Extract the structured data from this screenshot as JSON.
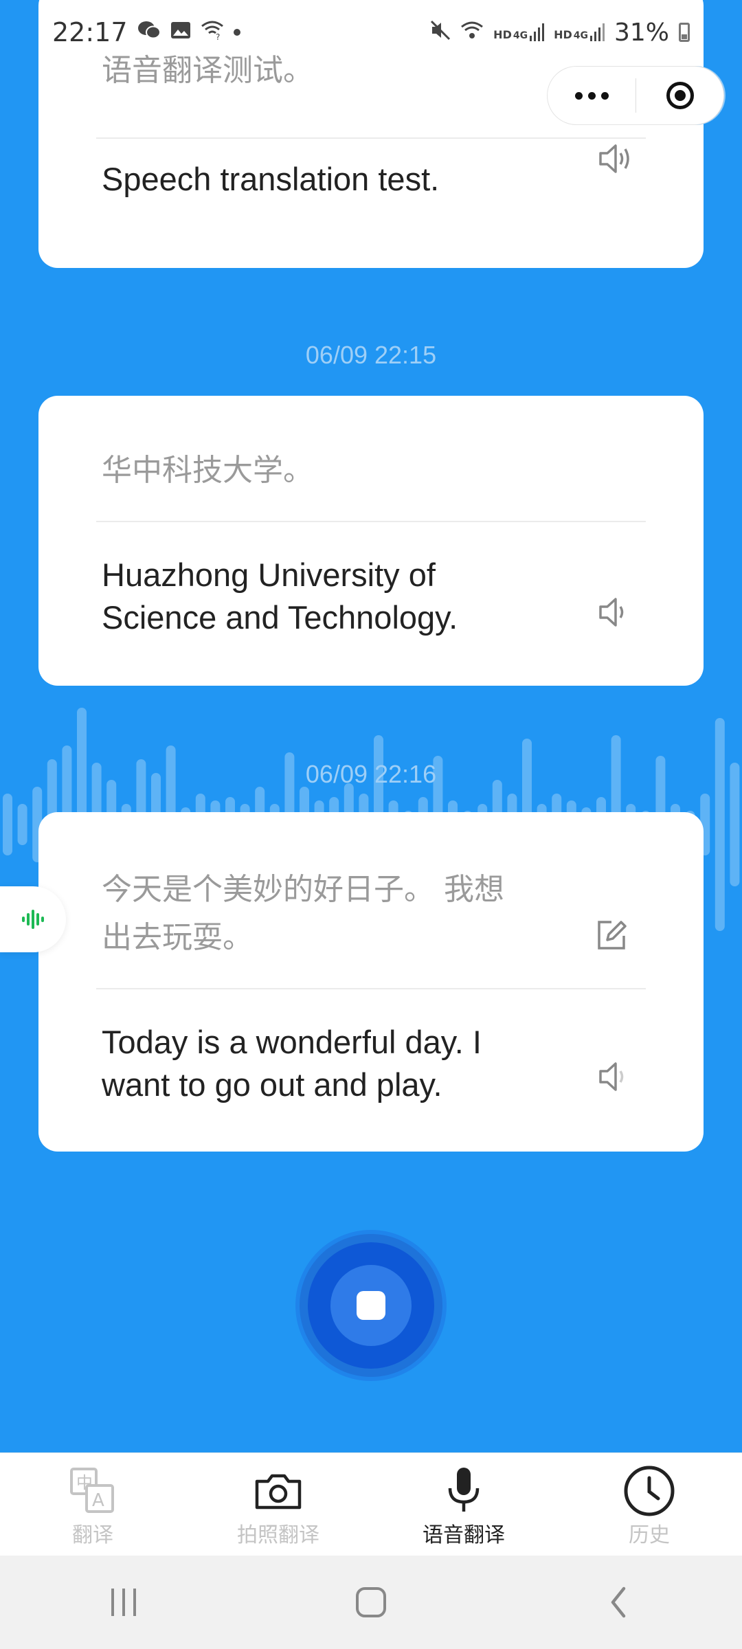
{
  "status_bar": {
    "time": "22:17",
    "battery": "31%",
    "left_icons": [
      "wechat-icon",
      "image-icon",
      "wifi-question-icon",
      "dot-icon"
    ],
    "right_icons": [
      "mute-icon",
      "wifi-icon",
      "hd-4g-signal-icon",
      "hd-4g-signal-icon",
      "battery-icon"
    ],
    "hd_label": "HD",
    "net_label": "4G"
  },
  "capsule": {
    "more_icon": "more-dots-icon",
    "close_icon": "target-close-icon"
  },
  "history": [
    {
      "source": "语音翻译测试。",
      "target": "Speech translation test."
    },
    {
      "timestamp": "06/09 22:15",
      "source": "华中科技大学。",
      "target_lines": [
        "Huazhong University of",
        "Science and Technology."
      ]
    },
    {
      "timestamp": "06/09 22:16",
      "source_lines": [
        "今天是个美妙的好日子。 我想",
        "出去玩耍。"
      ],
      "target_lines": [
        "Today is a wonderful day. I",
        "want to go out and play."
      ]
    }
  ],
  "tabs": [
    {
      "label": "翻译",
      "icon": "translate-icon",
      "active": false
    },
    {
      "label": "拍照翻译",
      "icon": "camera-icon",
      "active": false
    },
    {
      "label": "语音翻译",
      "icon": "microphone-icon",
      "active": true
    },
    {
      "label": "历史",
      "icon": "clock-icon",
      "active": false
    }
  ],
  "colors": {
    "background": "#2196F3",
    "record": "#0E58D6",
    "accent_green": "#1DB954"
  }
}
